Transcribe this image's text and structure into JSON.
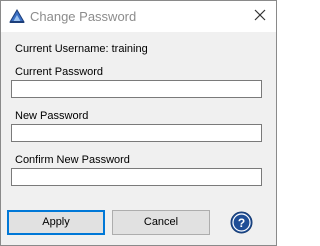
{
  "window": {
    "title": "Change Password",
    "app_icon": "drawing-app-icon",
    "close_icon": "close-icon"
  },
  "form": {
    "username_label": "Current Username:",
    "username_value": "training",
    "current_password_label": "Current Password",
    "current_password_value": "",
    "new_password_label": "New Password",
    "new_password_value": "",
    "confirm_password_label": "Confirm New Password",
    "confirm_password_value": ""
  },
  "buttons": {
    "apply_label": "Apply",
    "cancel_label": "Cancel",
    "help_icon": "help-icon"
  },
  "colors": {
    "accent": "#0078d7",
    "help_circle": "#1f4e96",
    "content_bg": "#f0f0f0"
  }
}
